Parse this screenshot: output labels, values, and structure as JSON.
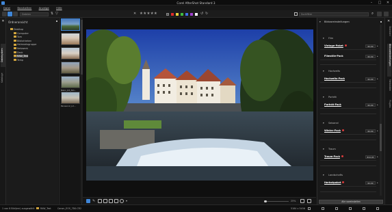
{
  "window": {
    "title": "Corel AfterShot Standard 3",
    "minimize": "–",
    "maximize": "□",
    "close": "✕"
  },
  "menu": [
    "Datei",
    "Bearbeiten",
    "Anzeige",
    "Hilfe"
  ],
  "toolbar": {
    "view_placeholder": "Dateien",
    "rating": "★★★★★",
    "search_placeholder": "Suchfilter",
    "label_colors": [
      "#e02b2b",
      "#e7d23b",
      "#3fbd3f",
      "#3f6ee8",
      "#a23fd2",
      "#ffffff"
    ],
    "accent": "#3f86d8"
  },
  "left_tabs": [
    "Dateisystem",
    "Kataloge"
  ],
  "folder_panel": {
    "title": "Ordneransicht",
    "tree": [
      {
        "label": "Desktop",
        "indent": 0,
        "selected": false
      },
      {
        "label": "Computer",
        "indent": 1,
        "selected": false
      },
      {
        "label": "Tom",
        "indent": 1,
        "selected": false
      },
      {
        "label": "Bibliotheken",
        "indent": 1,
        "selected": false
      },
      {
        "label": "Heimnetzgruppe",
        "indent": 1,
        "selected": false
      },
      {
        "label": "Netzwerk",
        "indent": 1,
        "selected": false
      },
      {
        "label": "Deck",
        "indent": 1,
        "selected": false
      },
      {
        "label": "RAW_Test",
        "indent": 1,
        "selected": true
      },
      {
        "label": "Temp",
        "indent": 1,
        "selected": false
      }
    ],
    "zoom_label": "50"
  },
  "thumbnails": [
    {
      "caption": ""
    },
    {
      "caption": ""
    },
    {
      "caption": ""
    },
    {
      "caption": ""
    },
    {
      "caption": "Nikon_D3_ISO..."
    },
    {
      "caption": "Panasonic_LX..."
    }
  ],
  "viewer": {
    "zoom": "25%"
  },
  "right_panel": {
    "title": "Bildvoreinstellungen",
    "sections": [
      {
        "name": "Film",
        "preset": "Vintage-Paket",
        "value": "€2,99",
        "has_dot": true,
        "preset2": "Filmstile-Pack",
        "value2": "€2,99"
      },
      {
        "name": "Hochzeits",
        "preset": "Hochzeits-Pack",
        "value": "€2,99",
        "has_dot": false
      },
      {
        "name": "Porträt",
        "preset": "Porträt-Pack",
        "value": "€2,99",
        "has_dot": false
      },
      {
        "name": "Saisonal",
        "preset": "Winter-Pack",
        "value": "€2,99",
        "has_dot": true
      },
      {
        "name": "Traum",
        "preset": "Traum-Pack",
        "value": "€14,45",
        "has_dot": true
      },
      {
        "name": "Landschafts",
        "preset": "Herbstpaket",
        "value": "€2,99",
        "has_dot": true
      }
    ],
    "button_all": "Alle voreinstellen"
  },
  "right_tabs": [
    "Standard",
    "Bildvoreinstellungen",
    "Metadaten",
    "Plugins"
  ],
  "status": {
    "count": "1 von 8 Bild(ern) ausgewählt",
    "folder": "RAW_Test",
    "filename": "Canon_EOS_7D0.CR2",
    "dims": "5184 x 3456"
  }
}
